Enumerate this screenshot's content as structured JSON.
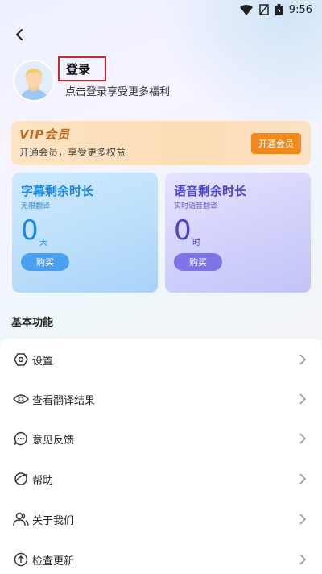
{
  "status_bar": {
    "time": "9:56",
    "icons": [
      "wifi-icon",
      "signal-off-icon",
      "battery-icon"
    ]
  },
  "header": {
    "back_icon": "back-arrow-icon"
  },
  "profile": {
    "avatar_icon": "avatar-icon",
    "login_label": "登录",
    "login_hint": "点击登录享受更多福利"
  },
  "vip": {
    "logo_text": "VIP会员",
    "subtitle": "开通会员，享受更多权益",
    "button_label": "开通会员"
  },
  "quota_cards": [
    {
      "title": "字幕剩余时长",
      "desc": "无限翻译",
      "value": "0",
      "unit": "天",
      "button": "购买"
    },
    {
      "title": "语音剩余时长",
      "desc": "实时语音翻译",
      "value": "0",
      "unit": "时",
      "button": "购买"
    }
  ],
  "section_title": "基本功能",
  "menu": [
    {
      "label": "设置",
      "icon": "settings-icon"
    },
    {
      "label": "查看翻译结果",
      "icon": "eye-icon"
    },
    {
      "label": "意见反馈",
      "icon": "feedback-icon"
    },
    {
      "label": "帮助",
      "icon": "help-icon"
    },
    {
      "label": "关于我们",
      "icon": "about-icon"
    },
    {
      "label": "检查更新",
      "icon": "update-icon"
    }
  ],
  "colors": {
    "vip_button": "#f08a1c",
    "subtitle_accent": "#1f86e0",
    "voice_accent": "#4b44c9",
    "highlight_box": "#d0232a"
  }
}
